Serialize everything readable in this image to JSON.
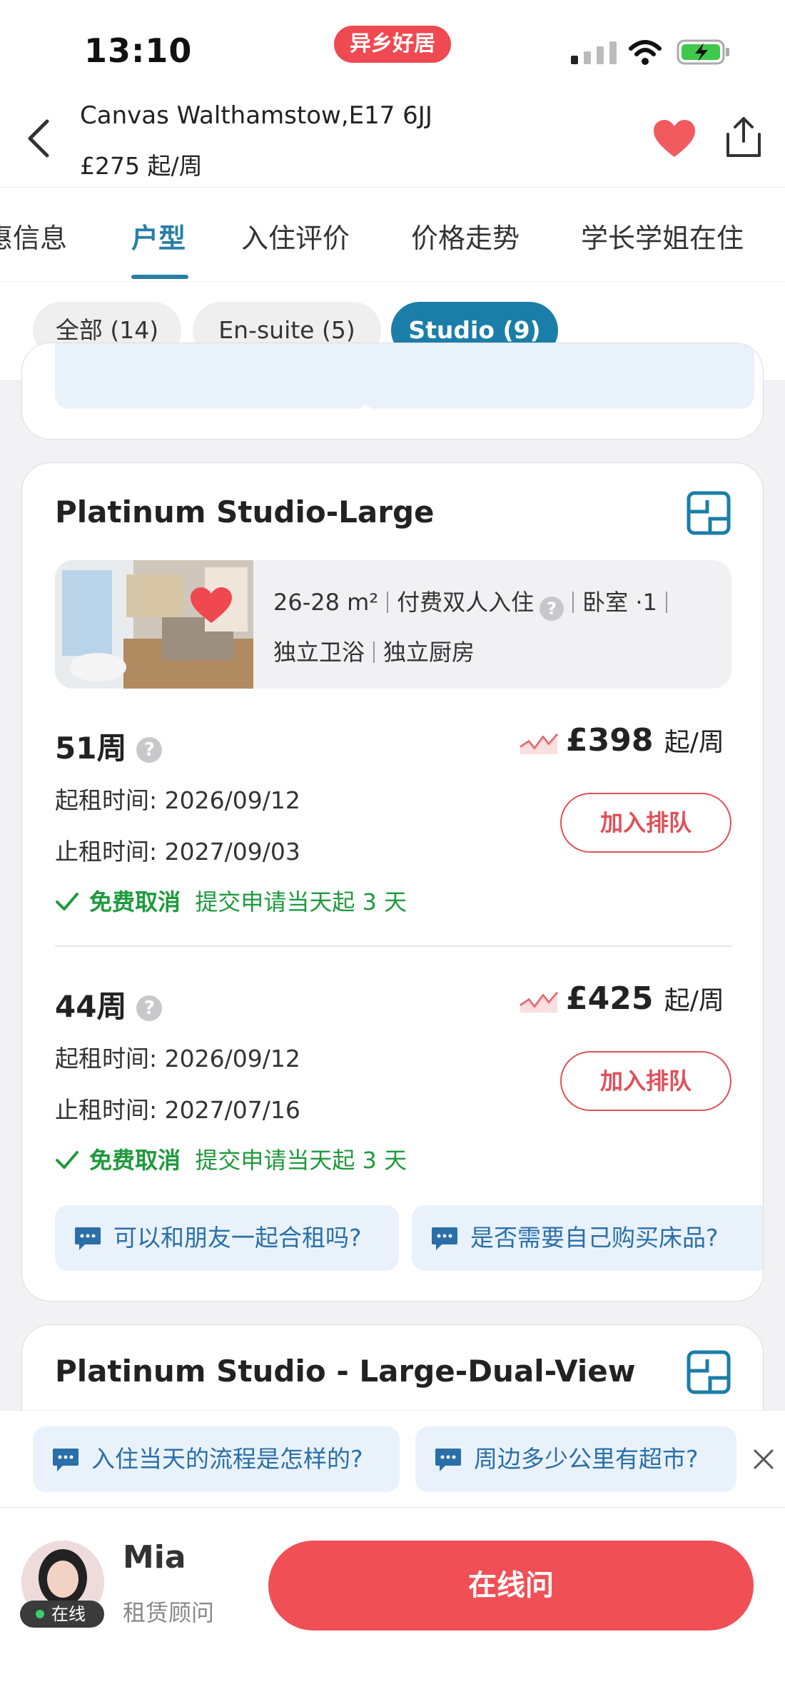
{
  "status_bar": {
    "time": "13:10",
    "brand": "异乡好居"
  },
  "header": {
    "title": "Canvas Walthamstow,E17 6JJ",
    "price": "£275 起/周"
  },
  "tabs": [
    {
      "label": "惠信息"
    },
    {
      "label": "户型",
      "active": true
    },
    {
      "label": "入住评价"
    },
    {
      "label": "价格走势"
    },
    {
      "label": "学长学姐在住"
    }
  ],
  "filters": [
    {
      "label": "全部 (14)"
    },
    {
      "label": "En-suite (5)"
    },
    {
      "label": "Studio (9)",
      "active": true
    }
  ],
  "room_card": {
    "title": "Platinum Studio-Large",
    "area": "26-28 m²",
    "occupancy": "付费双人入住",
    "bedroom": "卧室 ·1",
    "bath": "独立卫浴",
    "kitchen": "独立厨房",
    "options": [
      {
        "weeks": "51周",
        "price": "£398",
        "price_unit": "起/周",
        "start_label": "起租时间:",
        "start_date": "2026/09/12",
        "end_label": "止租时间:",
        "end_date": "2027/09/03",
        "cancel_bold": "免费取消",
        "cancel_text": "提交申请当天起 3 天",
        "queue_label": "加入排队"
      },
      {
        "weeks": "44周",
        "price": "£425",
        "price_unit": "起/周",
        "start_label": "起租时间:",
        "start_date": "2026/09/12",
        "end_label": "止租时间:",
        "end_date": "2027/07/16",
        "cancel_bold": "免费取消",
        "cancel_text": "提交申请当天起 3 天",
        "queue_label": "加入排队"
      }
    ],
    "faq": [
      "可以和朋友一起合租吗?",
      "是否需要自己购买床品?"
    ]
  },
  "next_card": {
    "title": "Platinum Studio - Large-Dual-View"
  },
  "bottom_faq": [
    "入住当天的流程是怎样的?",
    "周边多少公里有超市?"
  ],
  "agent": {
    "name": "Mia",
    "role": "租赁顾问",
    "status": "在线",
    "cta": "在线问"
  },
  "colors": {
    "accent_blue": "#1a7ea8",
    "brand_red": "#f04f55",
    "success_green": "#1e9a3c"
  }
}
